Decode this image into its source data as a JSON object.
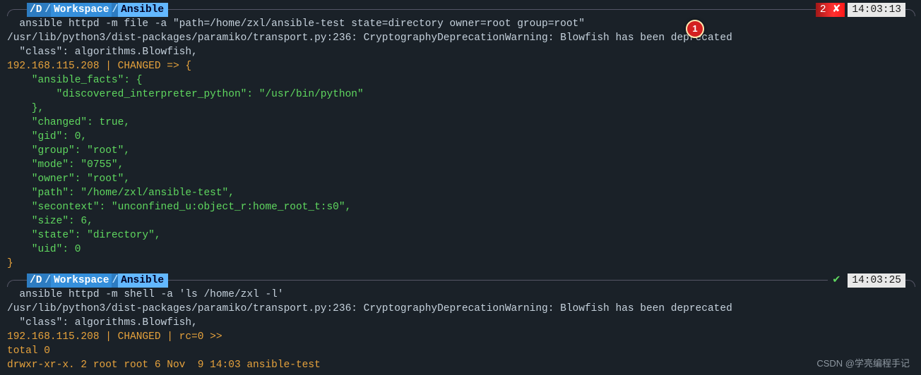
{
  "prompt1": {
    "path_d": "/D",
    "path_ws": "Workspace",
    "path_ans": "Ansible",
    "status_badge": "2 ✘",
    "time": "14:03:13"
  },
  "cmd1": "  ansible httpd -m file -a \"path=/home/zxl/ansible-test state=directory owner=root group=root\"",
  "warn1": "/usr/lib/python3/dist-packages/paramiko/transport.py:236: CryptographyDeprecationWarning: Blowfish has been deprecated",
  "warn2": "  \"class\": algorithms.Blowfish,",
  "host1": "192.168.115.208 | CHANGED => {",
  "json_lines": [
    "    \"ansible_facts\": {",
    "        \"discovered_interpreter_python\": \"/usr/bin/python\"",
    "    },",
    "    \"changed\": true,",
    "    \"gid\": 0,",
    "    \"group\": \"root\",",
    "    \"mode\": \"0755\",",
    "    \"owner\": \"root\",",
    "    \"path\": \"/home/zxl/ansible-test\",",
    "    \"secontext\": \"unconfined_u:object_r:home_root_t:s0\",",
    "    \"size\": 6,",
    "    \"state\": \"directory\",",
    "    \"uid\": 0",
    "}"
  ],
  "prompt2": {
    "path_d": "/D",
    "path_ws": "Workspace",
    "path_ans": "Ansible",
    "status_check": "✔",
    "time": "14:03:25"
  },
  "cmd2": "  ansible httpd -m shell -a 'ls /home/zxl -l'",
  "warn3": "/usr/lib/python3/dist-packages/paramiko/transport.py:236: CryptographyDeprecationWarning: Blowfish has been deprecated",
  "warn4": "  \"class\": algorithms.Blowfish,",
  "host2": "192.168.115.208 | CHANGED | rc=0 >>",
  "ls1": "total 0",
  "ls2": "drwxr-xr-x. 2 root root 6 Nov  9 14:03 ansible-test",
  "callout": "1",
  "watermark": "CSDN @学亮编程手记"
}
